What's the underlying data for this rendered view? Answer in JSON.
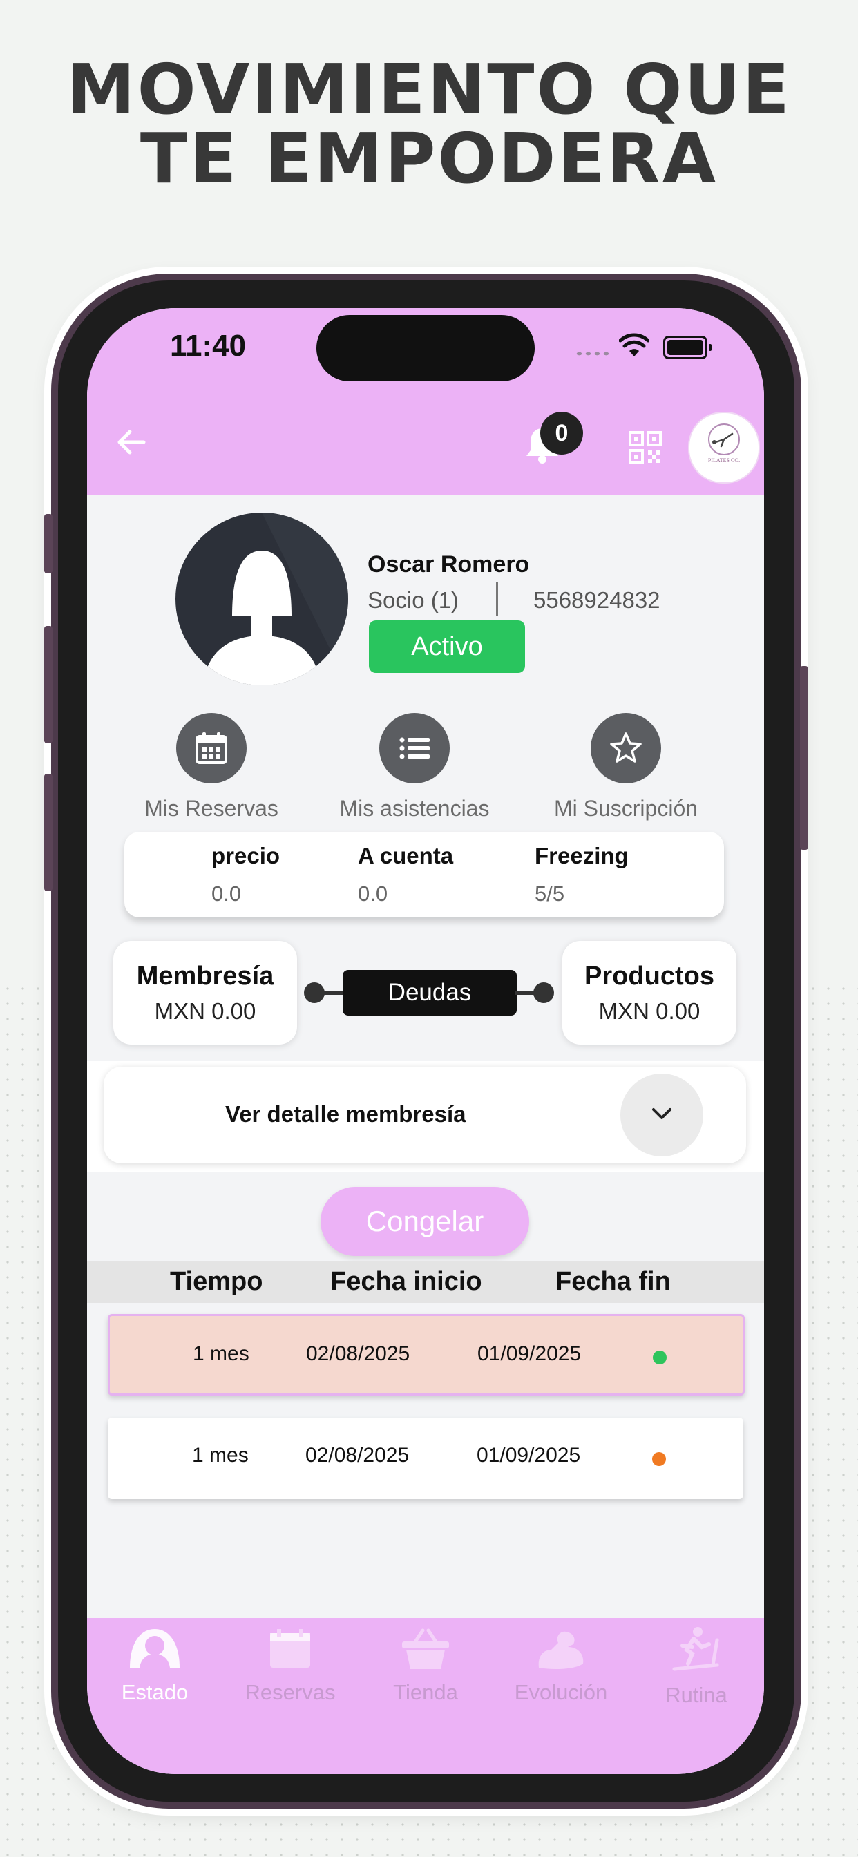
{
  "headline": {
    "line1": "MOVIMIENTO QUE",
    "line2": "TE EMPODERA"
  },
  "status_bar": {
    "time": "11:40"
  },
  "header": {
    "notification_count": "0",
    "logo_text": "PILATES CO."
  },
  "profile": {
    "name": "Oscar Romero",
    "role": "Socio (1)",
    "phone": "5568924832",
    "status": "Activo"
  },
  "actions": [
    {
      "label": "Mis Reservas",
      "icon": "calendar-icon"
    },
    {
      "label": "Mis asistencias",
      "icon": "list-icon"
    },
    {
      "label": "Mi Suscripción",
      "icon": "star-icon"
    }
  ],
  "stats": {
    "precio_label": "precio",
    "precio_value": "0.0",
    "cuenta_label": "A cuenta",
    "cuenta_value": "0.0",
    "freezing_label": "Freezing",
    "freezing_value": "5/5"
  },
  "debts": {
    "membership_label": "Membresía",
    "membership_value": "MXN 0.00",
    "center_label": "Deudas",
    "products_label": "Productos",
    "products_value": "MXN 0.00"
  },
  "detail": {
    "label": "Ver detalle membresía"
  },
  "freeze_button": "Congelar",
  "table": {
    "headers": [
      "Tiempo",
      "Fecha inicio",
      "Fecha fin"
    ],
    "rows": [
      {
        "tiempo": "1 mes",
        "inicio": "02/08/2025",
        "fin": "01/09/2025",
        "status_color": "#2ec45c"
      },
      {
        "tiempo": "1 mes",
        "inicio": "02/08/2025",
        "fin": "01/09/2025",
        "status_color": "#f07a22"
      }
    ]
  },
  "bottom_nav": [
    {
      "label": "Estado",
      "icon": "user-icon",
      "active": true
    },
    {
      "label": "Reservas",
      "icon": "calendar-icon"
    },
    {
      "label": "Tienda",
      "icon": "basket-icon"
    },
    {
      "label": "Evolución",
      "icon": "muscle-icon"
    },
    {
      "label": "Rutina",
      "icon": "treadmill-icon"
    }
  ],
  "colors": {
    "accent": "#ecb2f6",
    "active_green": "#29c55e",
    "background": "#f3f4f6",
    "headline": "#383838"
  }
}
